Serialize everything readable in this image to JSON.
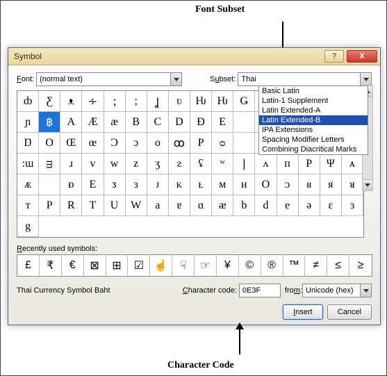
{
  "annotations": {
    "top": "Font Subset",
    "bottom": "Character Code"
  },
  "titlebar": {
    "title": "Symbol",
    "help": "?",
    "close": "X"
  },
  "font": {
    "label": "Font:",
    "value": "(normal text)"
  },
  "subset": {
    "label": "Subset:",
    "value": "Thai",
    "options": [
      "Basic Latin",
      "Latin-1 Supplement",
      "Latin Extended-A",
      "Latin Extended-B",
      "IPA Extensions",
      "Spacing Modifier Letters",
      "Combining Diacritical Marks"
    ],
    "selected_index": 3
  },
  "grid": {
    "rows": [
      [
        "ȸ",
        "Ƹ",
        "ᴥ",
        "∻",
        "⁏",
        ";",
        "Ʝ",
        "ʋ",
        "Ƕ",
        "Ƕ",
        "Ǥ",
        " ",
        " ",
        " ",
        " ",
        " "
      ],
      [
        "ɲ",
        "฿",
        "A",
        "Æ",
        "æ",
        "B",
        "C",
        "D",
        "Ð",
        "E",
        " ",
        " ",
        " ",
        " ",
        " ",
        " "
      ],
      [
        "Ŋ",
        "O",
        "Œ",
        "œ",
        "Ɔ",
        "ɔ",
        "ᴏ",
        "ꝏ",
        "P",
        "ᴑ",
        "",
        "",
        "",
        "",
        "",
        ""
      ],
      [
        ":ɯ",
        "ᴟ",
        "ɹ",
        "v",
        "w",
        "z",
        "ʒ",
        "ᴤ",
        "ʢ",
        "ʷ",
        "∣",
        "ᴧ",
        "п",
        "P",
        "Ψ",
        "ᴀ",
        "ᴁ"
      ],
      [
        " ",
        "ᴆ",
        "E",
        "ᴣ",
        "ɜ",
        "ᴊ",
        "ᴋ",
        "ᴌ",
        "ᴍ",
        "ᴎ",
        "O",
        "ᴐ",
        "ᴕ",
        "ᴙ",
        "ᴚ",
        "ᴛ"
      ],
      [
        "P",
        "R",
        "T",
        "U",
        "W",
        "a",
        "ɐ",
        "ɑ",
        "ᴂ",
        "b",
        "d",
        "e",
        "ə",
        "ɛ",
        "ɜ",
        "g"
      ]
    ],
    "selected": {
      "row": 1,
      "col": 1
    }
  },
  "recent": {
    "label": "Recently used symbols:",
    "cells": [
      "£",
      "₹",
      "€",
      "⊠",
      "⊞",
      "☑",
      "☝",
      "☟",
      "☞",
      "¥",
      "©",
      "®",
      "™",
      "≠",
      "≤",
      "≥"
    ]
  },
  "desc": "Thai Currency Symbol Baht",
  "cc": {
    "label": "Character code:",
    "value": "0E3F"
  },
  "from": {
    "label": "from:",
    "value": "Unicode (hex)"
  },
  "buttons": {
    "insert": "Insert",
    "cancel": "Cancel"
  }
}
